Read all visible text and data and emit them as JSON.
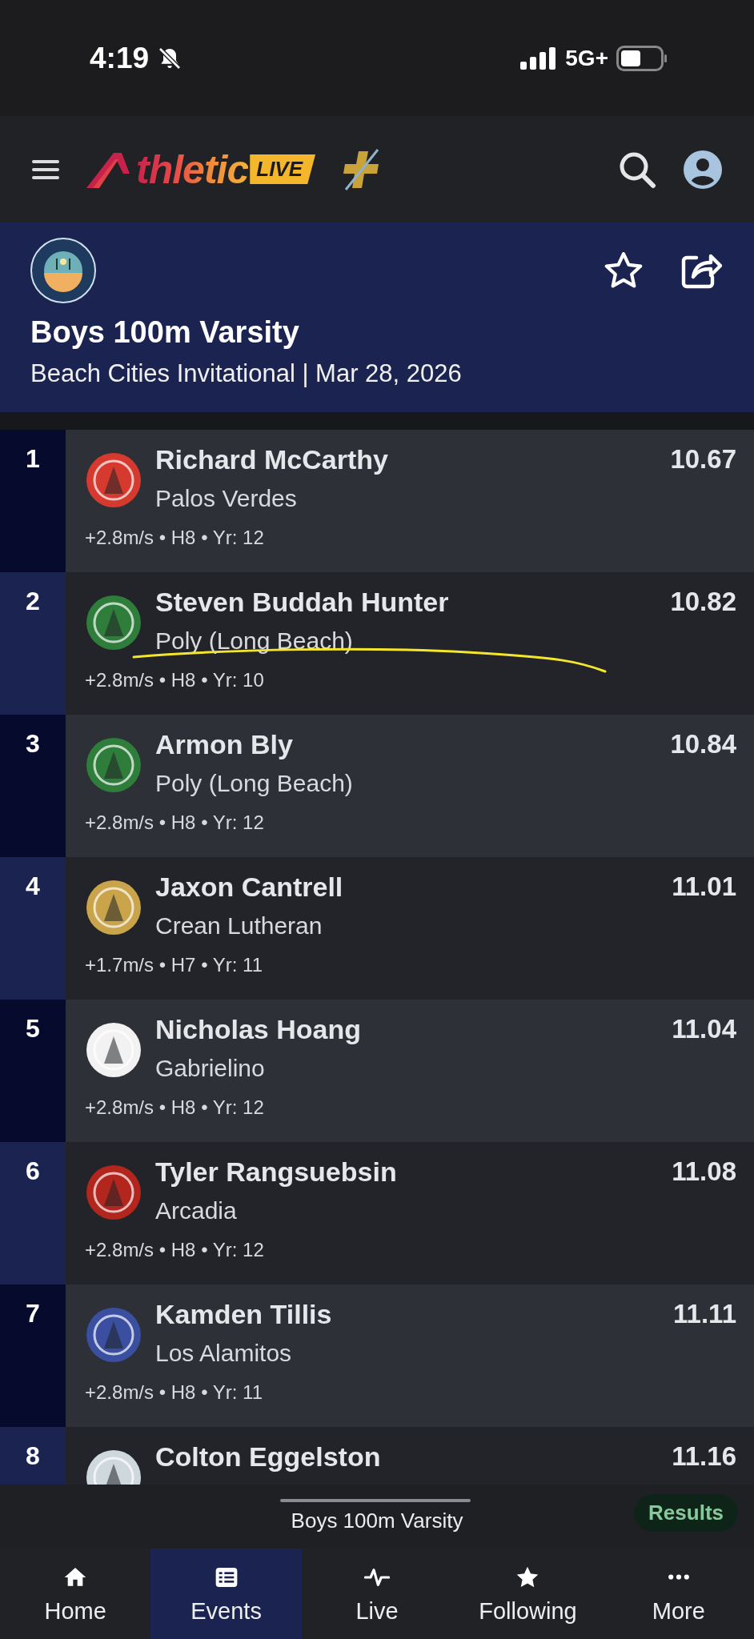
{
  "status_bar": {
    "time": "4:19",
    "network": "5G+"
  },
  "app_bar": {
    "logo_text": "thletic",
    "logo_badge": "LIVE"
  },
  "event": {
    "title": "Boys 100m Varsity",
    "subtitle": "Beach Cities Invitational | Mar 28, 2026",
    "favorited": false
  },
  "results": [
    {
      "place": "1",
      "name": "Richard McCarthy",
      "school": "Palos Verdes",
      "mark": "10.67",
      "details": "+2.8m/s • H8 • Yr: 12",
      "color": "#d63a2f"
    },
    {
      "place": "2",
      "name": "Steven Buddah Hunter",
      "school": "Poly (Long Beach)",
      "mark": "10.82",
      "details": "+2.8m/s • H8 • Yr: 10",
      "color": "#2f7d3a"
    },
    {
      "place": "3",
      "name": "Armon Bly",
      "school": "Poly (Long Beach)",
      "mark": "10.84",
      "details": "+2.8m/s • H8 • Yr: 12",
      "color": "#2f7d3a"
    },
    {
      "place": "4",
      "name": "Jaxon Cantrell",
      "school": "Crean Lutheran",
      "mark": "11.01",
      "details": "+1.7m/s • H7 • Yr: 11",
      "color": "#c9a44a"
    },
    {
      "place": "5",
      "name": "Nicholas Hoang",
      "school": "Gabrielino",
      "mark": "11.04",
      "details": "+2.8m/s • H8 • Yr: 12",
      "color": "#f2f2f2"
    },
    {
      "place": "6",
      "name": "Tyler Rangsuebsin",
      "school": "Arcadia",
      "mark": "11.08",
      "details": "+2.8m/s • H8 • Yr: 12",
      "color": "#b3261e"
    },
    {
      "place": "7",
      "name": "Kamden Tillis",
      "school": "Los Alamitos",
      "mark": "11.11",
      "details": "+2.8m/s • H8 • Yr: 11",
      "color": "#3a4fa0"
    },
    {
      "place": "8",
      "name": "Colton Eggelston",
      "mark": "11.16",
      "color": "#cfd8dc"
    }
  ],
  "now_playing": {
    "title": "Boys 100m Varsity",
    "badge": "Results"
  },
  "tabs": [
    {
      "label": "Home",
      "kind": "home",
      "selected": false
    },
    {
      "label": "Events",
      "kind": "list",
      "selected": true
    },
    {
      "label": "Live",
      "kind": "pulse",
      "selected": false
    },
    {
      "label": "Following",
      "kind": "star",
      "selected": false
    },
    {
      "label": "More",
      "kind": "dots",
      "selected": false
    }
  ]
}
